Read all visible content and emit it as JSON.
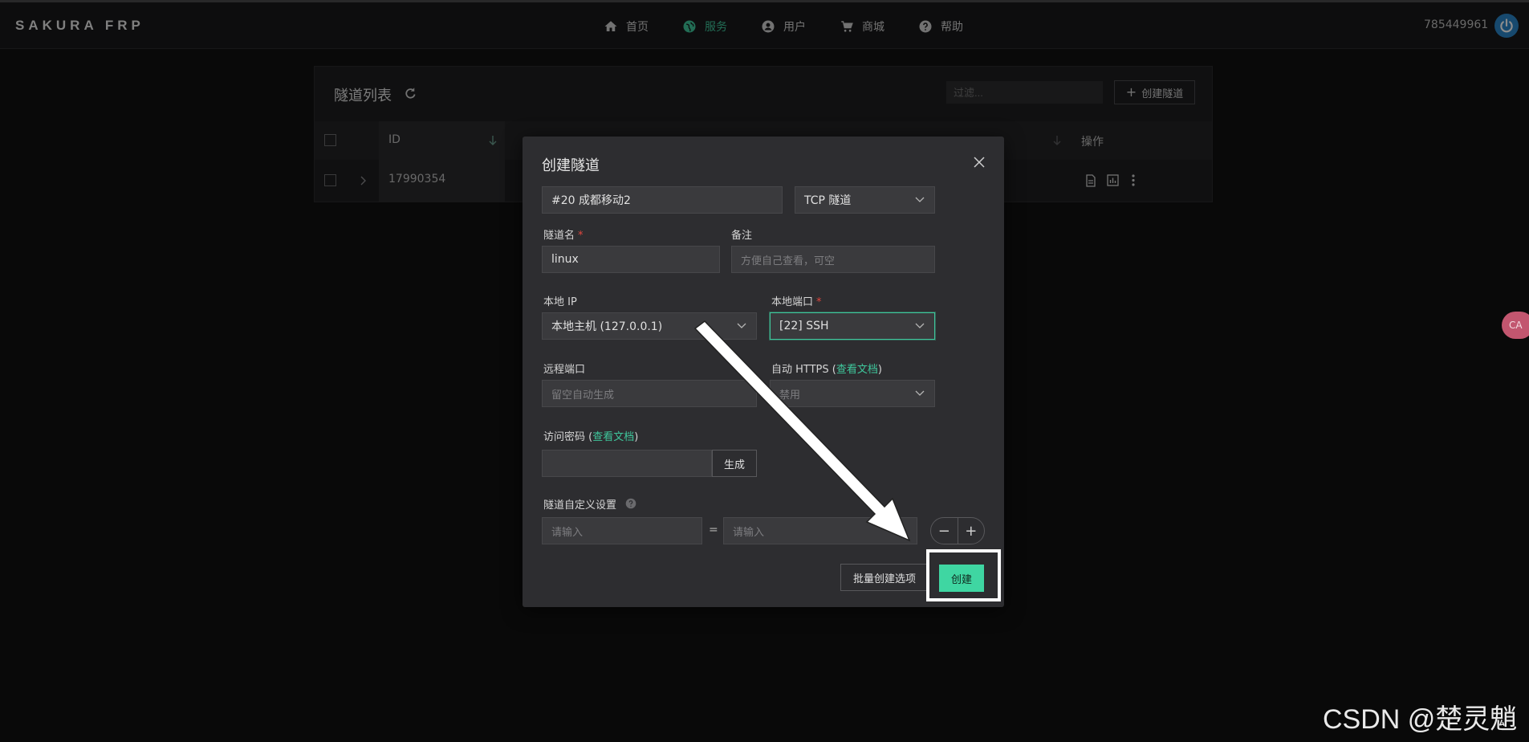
{
  "topbar": {
    "logo": "SAKURA FRP",
    "nav": [
      {
        "label": "首页",
        "icon": "home-icon",
        "active": false
      },
      {
        "label": "服务",
        "icon": "globe-icon",
        "active": true
      },
      {
        "label": "用户",
        "icon": "user-icon",
        "active": false
      },
      {
        "label": "商城",
        "icon": "cart-icon",
        "active": false
      },
      {
        "label": "帮助",
        "icon": "help-icon",
        "active": false
      }
    ],
    "user_id": "785449961",
    "accent_color": "#3fc79c"
  },
  "tunnel_list": {
    "title": "隧道列表",
    "filter_placeholder": "过滤...",
    "create_label": "创建隧道",
    "columns": [
      "ID",
      "操作"
    ],
    "rows": [
      {
        "id": "17990354"
      }
    ]
  },
  "modal": {
    "title": "创建隧道",
    "node_value": "#20 成都移动2",
    "type_value": "TCP 隧道",
    "name_label": "隧道名",
    "name_value": "linux",
    "note_label": "备注",
    "note_placeholder": "方便自己查看，可空",
    "local_ip_label": "本地 IP",
    "local_ip_value": "本地主机 (127.0.0.1)",
    "local_port_label": "本地端口",
    "local_port_value": "[22] SSH",
    "remote_port_label": "远程端口",
    "remote_port_placeholder": "留空自动生成",
    "auto_https_label": "自动 HTTPS",
    "docs_link": "查看文档",
    "auto_https_value": "禁用",
    "access_password_label": "访问密码",
    "generate_label": "生成",
    "custom_label": "隧道自定义设置",
    "custom_key_placeholder": "请输入",
    "custom_value_placeholder": "请输入",
    "equals": "=",
    "minus": "−",
    "plus": "+",
    "batch_label": "批量创建选项",
    "submit_label": "创建",
    "submit_color": "#3fd6a2"
  },
  "translate_badge": "CA",
  "watermark": "CSDN @楚灵魈"
}
